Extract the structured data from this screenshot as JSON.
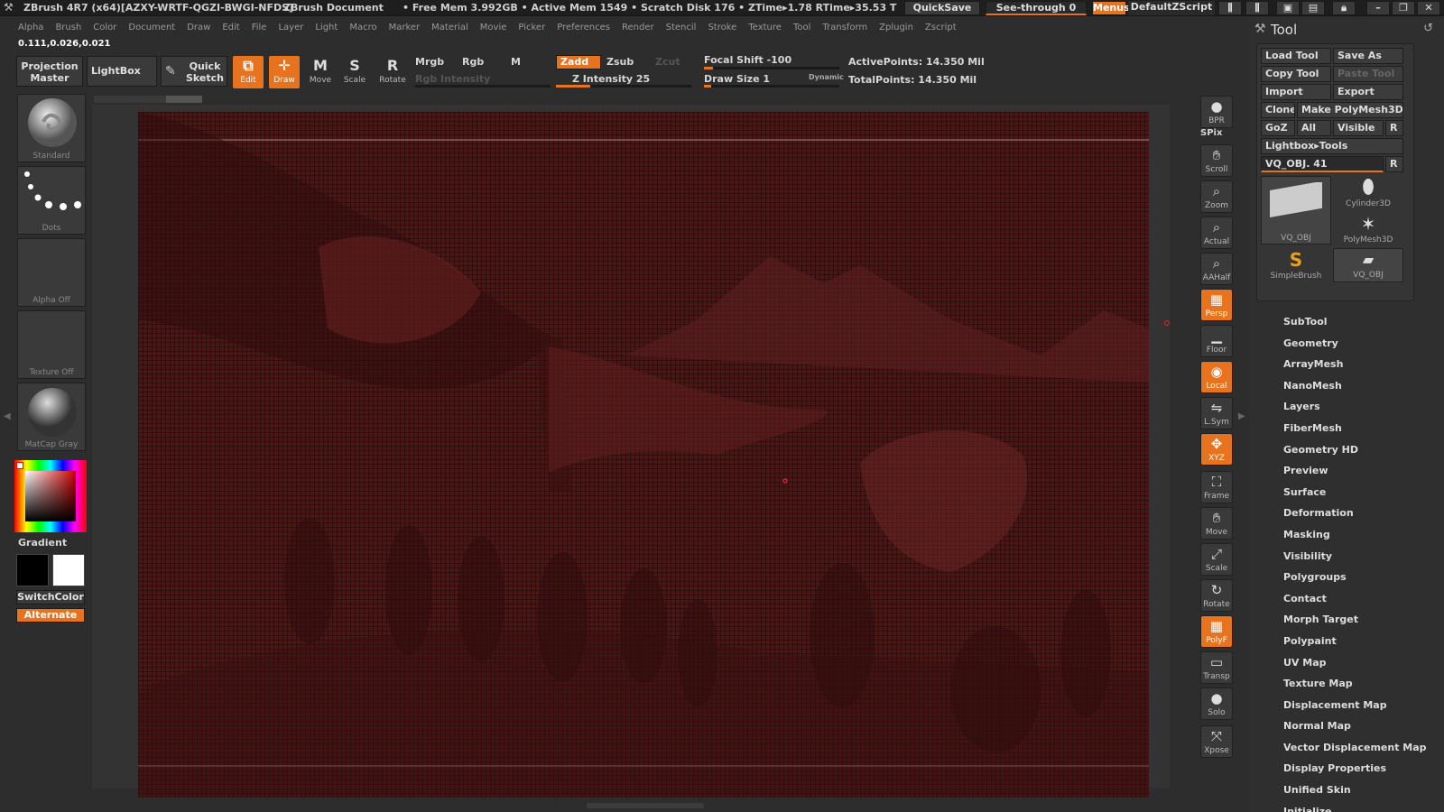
{
  "titlebar": {
    "app_title": "ZBrush 4R7 (x64)[AZXY-WRTF-QGZI-BWGI-NFDS]",
    "doc_title": "ZBrush Document",
    "stats": "• Free Mem 3.992GB • Active Mem 1549 • Scratch Disk 176 • ZTime▸1.78 RTime▸35.53 T",
    "quicksave": "QuickSave",
    "seethrough": "See-through  0",
    "menus": "Menus",
    "script": "DefaultZScript"
  },
  "menubar": [
    "Alpha",
    "Brush",
    "Color",
    "Document",
    "Draw",
    "Edit",
    "File",
    "Layer",
    "Light",
    "Macro",
    "Marker",
    "Material",
    "Movie",
    "Picker",
    "Preferences",
    "Render",
    "Stencil",
    "Stroke",
    "Texture",
    "Tool",
    "Transform",
    "Zplugin",
    "Zscript"
  ],
  "coords": "0.111,0.026,0.021",
  "topshelf": {
    "projection_master": "Projection Master",
    "lightbox": "LightBox",
    "quick_sketch": "Quick Sketch",
    "edit": "Edit",
    "draw": "Draw",
    "move": "Move",
    "scale": "Scale",
    "rotate": "Rotate",
    "mrgb": "Mrgb",
    "rgb": "Rgb",
    "m": "M",
    "zadd": "Zadd",
    "zsub": "Zsub",
    "zcut": "Zcut",
    "rgb_intensity": "Rgb Intensity",
    "z_intensity": "Z Intensity 25",
    "focal_shift": "Focal Shift -100",
    "draw_size": "Draw Size 1",
    "dynamic": "Dynamic",
    "active_points": "ActivePoints: 14.350 Mil",
    "total_points": "TotalPoints: 14.350 Mil",
    "z_intensity_level": 0.25,
    "draw_size_level": 0.02,
    "focal_shift_level": 0.0
  },
  "leftpanel": {
    "standard": "Standard",
    "dots": "Dots",
    "alpha_off": "Alpha  Off",
    "texture_off": "Texture  Off",
    "matcap": "MatCap  Gray",
    "gradient": "Gradient",
    "switchcolor": "SwitchColor",
    "alternate": "Alternate"
  },
  "rightshelf": [
    {
      "label": "BPR",
      "icon": "bpr-sphere-icon"
    },
    {
      "label": "SPix",
      "icon": "spix-icon"
    },
    {
      "label": "Scroll",
      "icon": "hand-icon"
    },
    {
      "label": "Zoom",
      "icon": "magnifier-icon"
    },
    {
      "label": "Actual",
      "icon": "magnifier-icon"
    },
    {
      "label": "AAHalf",
      "icon": "magnifier-icon"
    },
    {
      "label": "Persp",
      "icon": "perspective-icon"
    },
    {
      "label": "Floor",
      "icon": "floor-icon"
    },
    {
      "label": "Local",
      "icon": "local-icon"
    },
    {
      "label": "L.Sym",
      "icon": "symmetry-icon"
    },
    {
      "label": "XYZ",
      "icon": "xyz-icon"
    },
    {
      "label": "Frame",
      "icon": "frame-icon"
    },
    {
      "label": "Move",
      "icon": "hand-icon"
    },
    {
      "label": "Scale",
      "icon": "scale-icon"
    },
    {
      "label": "Rotate",
      "icon": "rotate-icon"
    },
    {
      "label": "PolyF",
      "icon": "polyframe-icon"
    },
    {
      "label": "Transp",
      "icon": "transparency-icon"
    },
    {
      "label": "Solo",
      "icon": "solo-icon"
    },
    {
      "label": "Xpose",
      "icon": "xpose-icon"
    }
  ],
  "toolpanel": {
    "title": "Tool",
    "load_tool": "Load Tool",
    "save_as": "Save As",
    "copy_tool": "Copy Tool",
    "paste_tool": "Paste Tool",
    "import": "Import",
    "export": "Export",
    "clone": "Clone",
    "make_polymesh": "Make PolyMesh3D",
    "goz": "GoZ",
    "all": "All",
    "visible": "Visible",
    "r": "R",
    "lightbox_tools": "Lightbox▸Tools",
    "current_tool": "VQ_OBJ. 41",
    "thumbs": [
      "VQ_OBJ",
      "Cylinder3D",
      "PolyMesh3D",
      "SimpleBrush",
      "VQ_OBJ"
    ],
    "menu": [
      "SubTool",
      "Geometry",
      "ArrayMesh",
      "NanoMesh",
      "Layers",
      "FiberMesh",
      "Geometry HD",
      "Preview",
      "Surface",
      "Deformation",
      "Masking",
      "Visibility",
      "Polygroups",
      "Contact",
      "Morph Target",
      "Polypaint",
      "UV Map",
      "Texture Map",
      "Displacement Map",
      "Normal Map",
      "Vector Displacement Map",
      "Display Properties",
      "Unified Skin",
      "Initialize"
    ]
  },
  "colors": {
    "accent": "#e8731f",
    "mesh": "#4a1717",
    "panel": "#2d2d2d"
  }
}
